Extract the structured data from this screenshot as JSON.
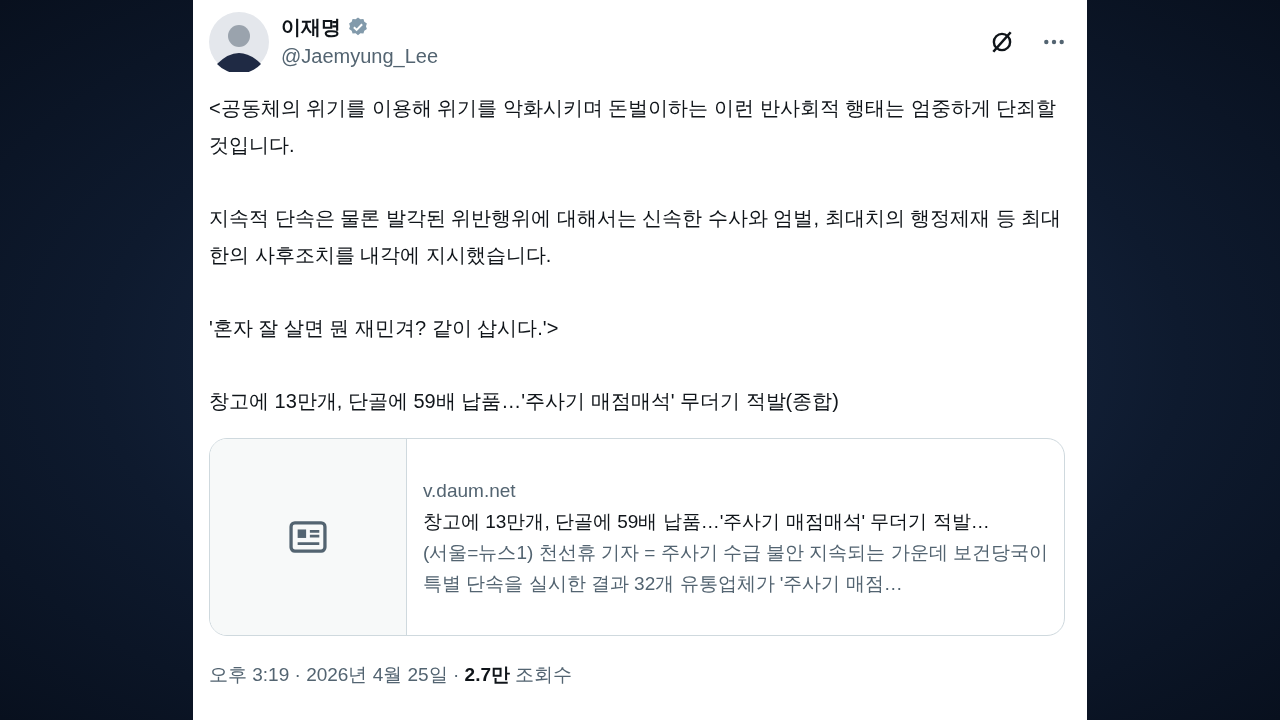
{
  "author": {
    "name": "이재명",
    "verified": true,
    "handle": "@Jaemyung_Lee"
  },
  "paragraphs": [
    "<공동체의 위기를 이용해 위기를 악화시키며 돈벌이하는 이런 반사회적 행태는 엄중하게 단죄할 것입니다.",
    "지속적 단속은 물론 발각된 위반행위에 대해서는 신속한 수사와 엄벌, 최대치의 행정제재 등 최대한의 사후조치를 내각에 지시했습니다.",
    "'혼자 잘 살면 뭔 재민겨? 같이 삽시다.'>",
    "창고에 13만개, 단골에 59배 납품…'주사기 매점매석' 무더기 적발(종합)"
  ],
  "link_card": {
    "domain": "v.daum.net",
    "title": "창고에 13만개, 단골에 59배 납품…'주사기 매점매석' 무더기 적발…",
    "description": "(서울=뉴스1) 천선휴 기자 = 주사기 수급 불안 지속되는 가운데 보건당국이 특별 단속을 실시한 결과 32개 유통업체가 '주사기 매점…"
  },
  "meta": "오후 3:19 · 2026년 4월 25일 · **2.7만** 조회수"
}
